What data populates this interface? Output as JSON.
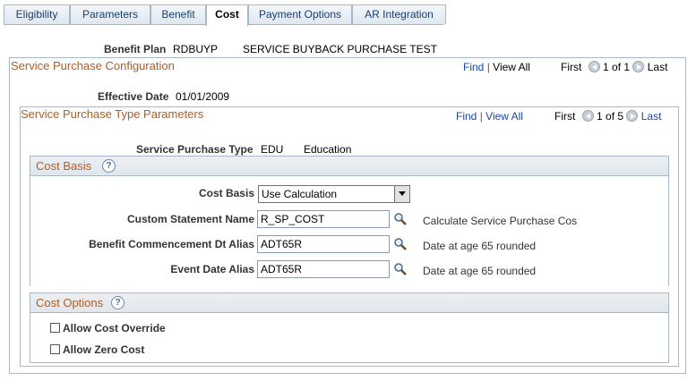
{
  "tabs": [
    {
      "label": "Eligibility"
    },
    {
      "label": "Parameters"
    },
    {
      "label": "Benefit"
    },
    {
      "label": "Cost"
    },
    {
      "label": "Payment Options"
    },
    {
      "label": "AR Integration"
    }
  ],
  "header": {
    "benefit_plan_label": "Benefit Plan",
    "benefit_plan_code": "RDBUYP",
    "benefit_plan_desc": "SERVICE BUYBACK PURCHASE TEST"
  },
  "config": {
    "title": "Service Purchase Configuration",
    "find": "Find",
    "sep": "|",
    "view_all": "View All",
    "first": "First",
    "count": "1 of 1",
    "last": "Last",
    "effective_date_label": "Effective Date",
    "effective_date_value": "01/01/2009"
  },
  "type_params": {
    "title": "Service Purchase Type Parameters",
    "find": "Find",
    "sep": "|",
    "view_all": "View All",
    "first": "First",
    "count": "1 of 5",
    "last": "Last",
    "type_label": "Service Purchase Type",
    "type_code": "EDU",
    "type_desc": "Education"
  },
  "cost_basis": {
    "title": "Cost Basis",
    "help": "?",
    "cost_basis_label": "Cost Basis",
    "cost_basis_value": "Use Calculation",
    "custom_statement_label": "Custom Statement Name",
    "custom_statement_value": "R_SP_COST",
    "custom_statement_desc": "Calculate Service Purchase Cos",
    "commencement_label": "Benefit Commencement Dt Alias",
    "commencement_value": "ADT65R",
    "commencement_desc": "Date at age 65 rounded",
    "event_label": "Event Date Alias",
    "event_value": "ADT65R",
    "event_desc": "Date at age 65 rounded"
  },
  "cost_options": {
    "title": "Cost Options",
    "help": "?",
    "allow_override_label": "Allow Cost Override",
    "allow_zero_label": "Allow Zero Cost"
  },
  "icons": {
    "lookup": "magnifier-icon",
    "nav_prev": "previous-arrow-icon",
    "nav_next": "next-arrow-icon",
    "help": "help-icon"
  },
  "colors": {
    "section_title": "#b15c23",
    "link": "#1a47a6",
    "border": "#a8b8c6"
  }
}
